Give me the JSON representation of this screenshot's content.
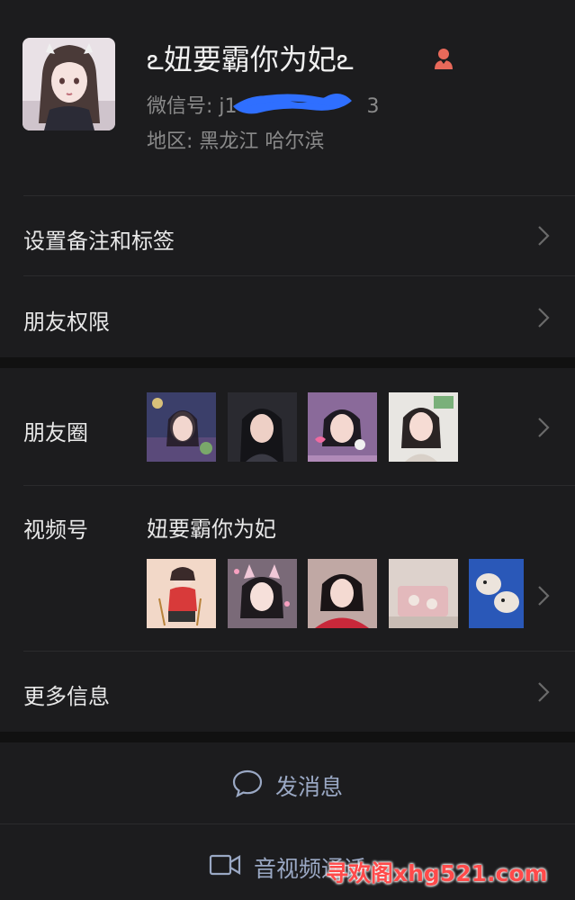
{
  "profile": {
    "nickname": "ఽ妞要霸你为妃ఽ",
    "wechat_id_label": "微信号: j1",
    "wechat_id_tail": "3",
    "region_label": "地区:",
    "region_value": "黑龙江  哈尔滨",
    "gender_icon": "female-icon"
  },
  "menu": {
    "remark_tags": "设置备注和标签",
    "friend_permissions": "朋友权限",
    "moments": "朋友圈",
    "channels": "视频号",
    "channels_name": "妞要霸你为妃",
    "more_info": "更多信息"
  },
  "actions": {
    "send_message": "发消息",
    "av_call": "音视频通话"
  },
  "watermark": "寻欢阁xhg521.com",
  "colors": {
    "background": "#1c1c1e",
    "section_gap": "#111111",
    "action_text": "#9aa8c4",
    "secondary_text": "#8a8a8a",
    "gender_icon": "#e8695a",
    "watermark": "#ff4a4a"
  }
}
